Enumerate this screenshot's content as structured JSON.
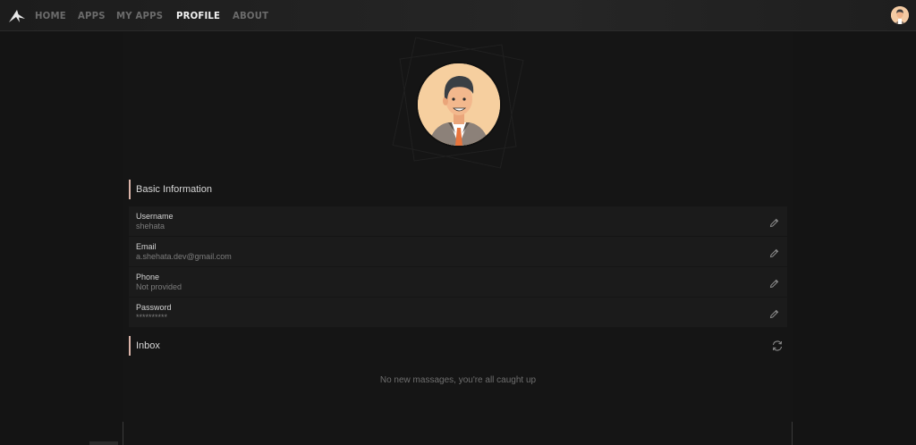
{
  "nav": {
    "links": [
      {
        "label": "HOME"
      },
      {
        "label": "APPS"
      },
      {
        "label": "MY APPS"
      },
      {
        "label": "PROFILE"
      },
      {
        "label": "ABOUT"
      }
    ]
  },
  "basic_info": {
    "title": "Basic Information",
    "rows": [
      {
        "label": "Username",
        "value": "shehata"
      },
      {
        "label": "Email",
        "value": "a.shehata.dev@gmail.com"
      },
      {
        "label": "Phone",
        "value": "Not provided"
      },
      {
        "label": "Password",
        "value": "**********"
      }
    ]
  },
  "inbox": {
    "title": "Inbox",
    "empty_message": "No new massages, you're all caught up"
  },
  "icons": {
    "logo": "logo-icon",
    "edit": "pencil-icon",
    "refresh": "refresh-icon"
  },
  "colors": {
    "background": "#141414",
    "navbar": "#262626",
    "accent_bar": "#d9b3a8",
    "active_nav": "#f2f2f2",
    "inactive_nav": "#6b6b6b",
    "row_bg": "#1b1b1b",
    "avatar_bg": "#f6cf9f"
  }
}
